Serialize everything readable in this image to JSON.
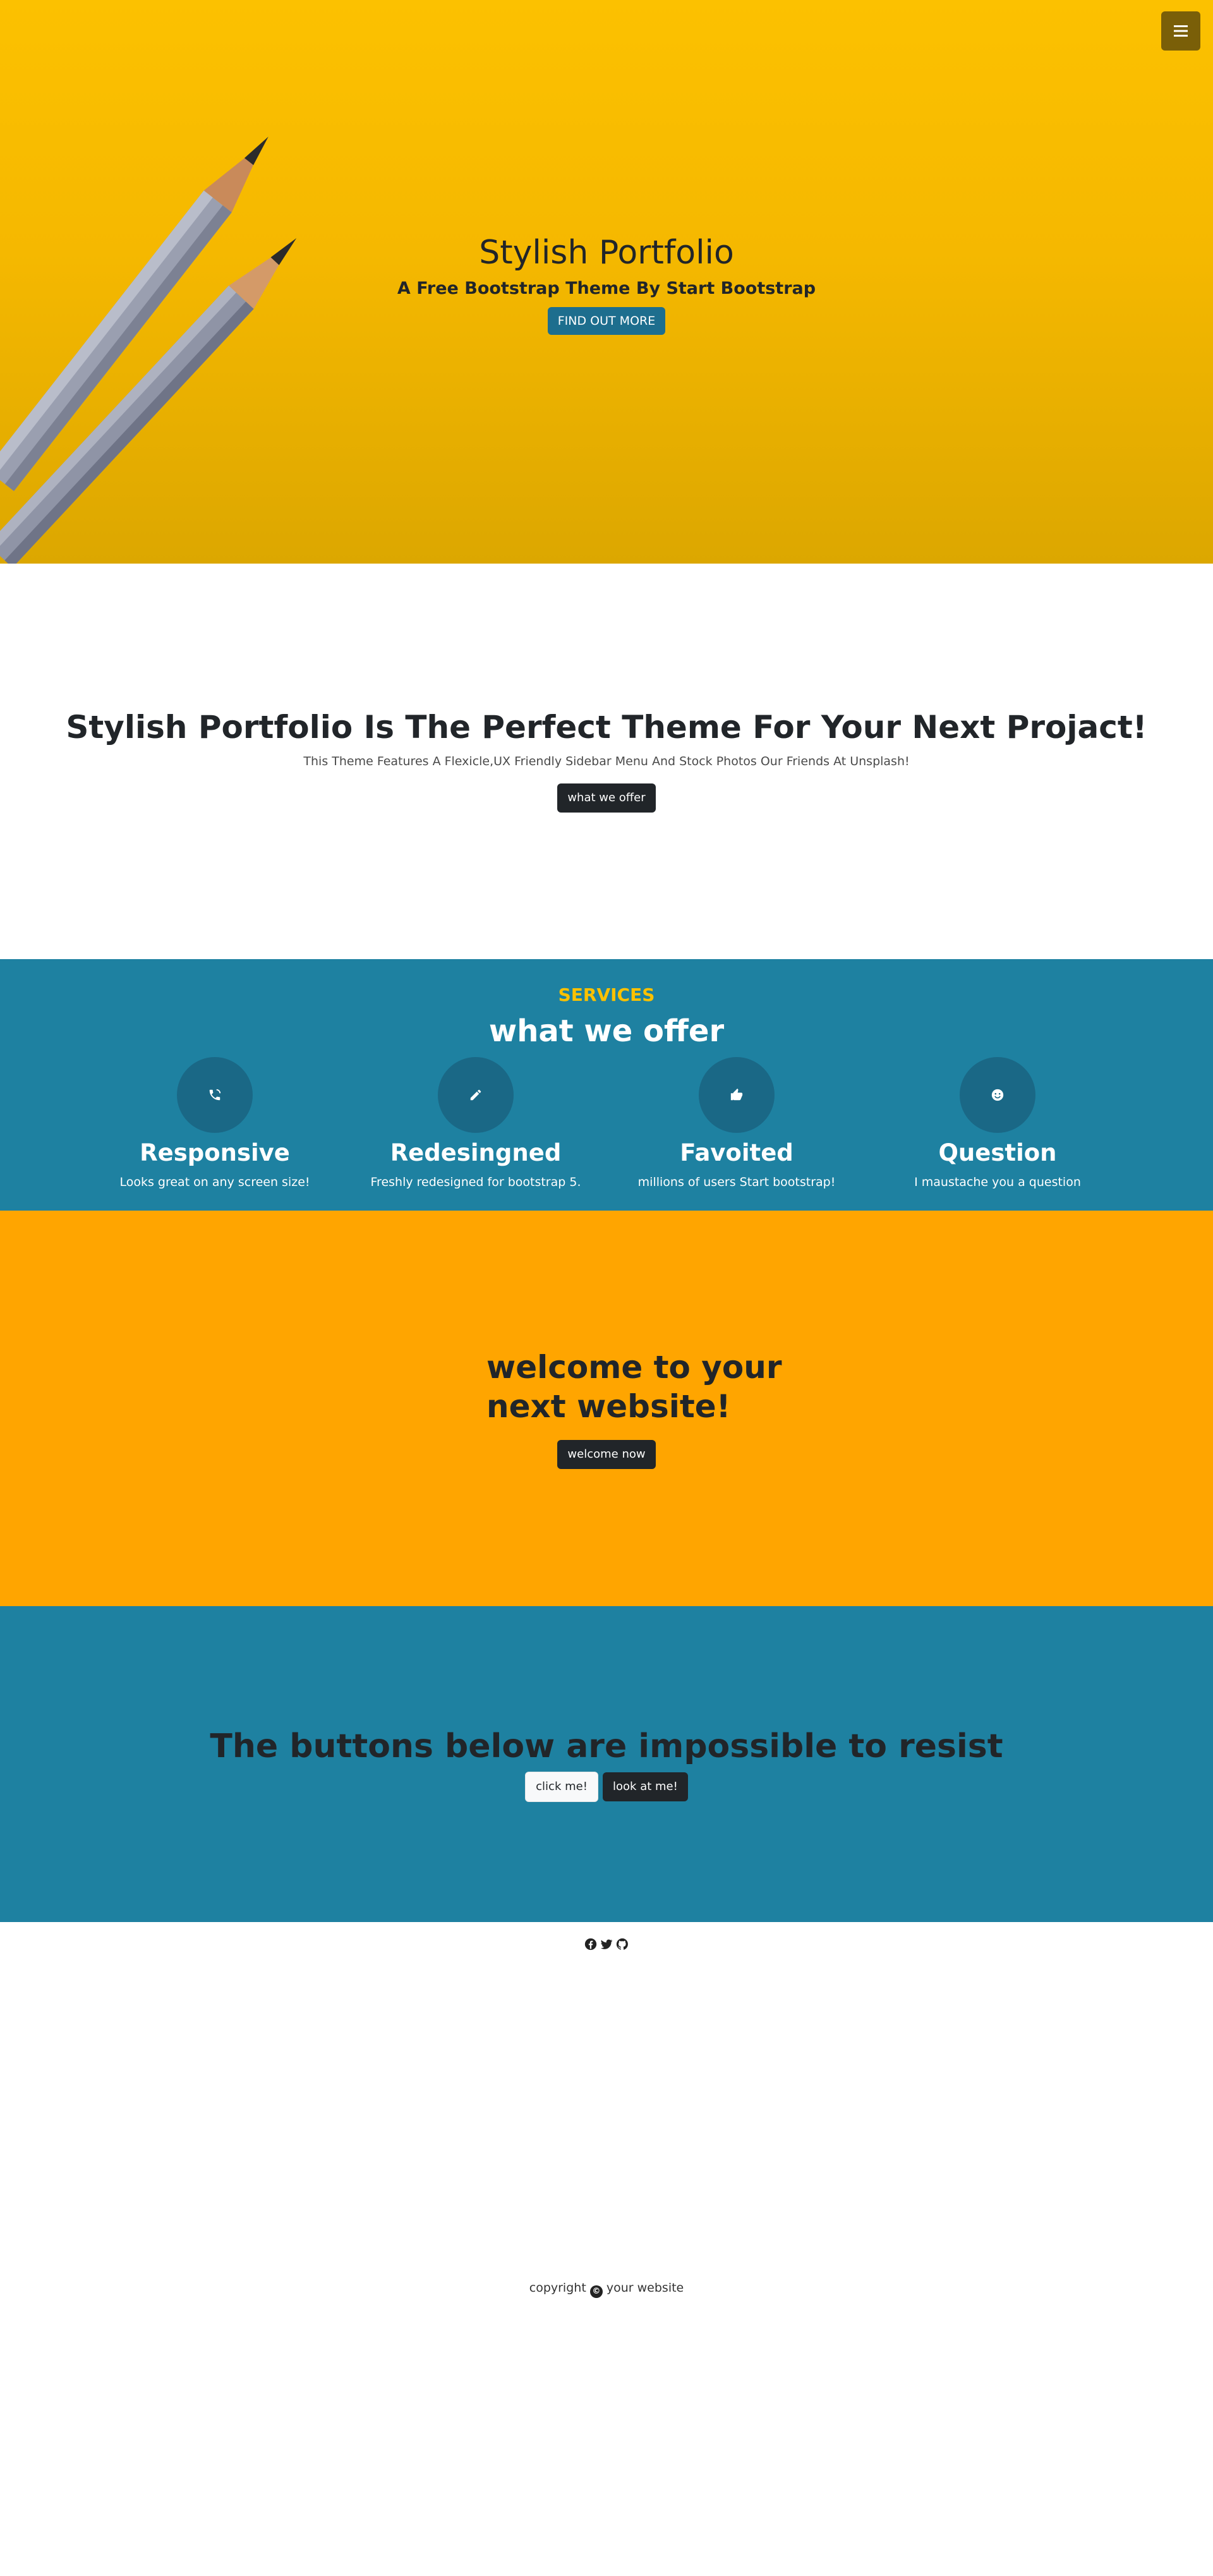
{
  "hero": {
    "title": "Stylish Portfolio",
    "subtitle": "A Free Bootstrap Theme By Start Bootstrap",
    "cta_label": "FIND OUT MORE",
    "menu_icon": "hamburger-icon"
  },
  "about": {
    "title": "Stylish Portfolio Is The Perfect Theme For Your Next Projact!",
    "text": "This Theme Features A Flexicle,UX Friendly Sidebar Menu And Stock Photos Our Friends At Unsplash!",
    "button_label": "what we offer"
  },
  "services": {
    "subheading": "SERVICES",
    "title": "what we offer",
    "items": [
      {
        "icon": "phone-icon",
        "name": "Responsive",
        "text": "Looks great on any screen size!"
      },
      {
        "icon": "pencil-icon",
        "name": "Redesingned",
        "text": "Freshly redesigned for bootstrap 5."
      },
      {
        "icon": "thumbs-up-icon",
        "name": "Favoited",
        "text": "millions of users Start bootstrap!"
      },
      {
        "icon": "smile-icon",
        "name": "Question",
        "text": "I maustache you a question"
      }
    ]
  },
  "callout": {
    "title_line1": "welcome to your",
    "title_line2": "next website!",
    "button_label": "welcome now"
  },
  "cta": {
    "title": "The buttons below are impossible to resist",
    "button1_label": "click me!",
    "button2_label": "look at me!"
  },
  "footer": {
    "social_icons": [
      "facebook-icon",
      "twitter-icon",
      "github-icon"
    ],
    "copyright_prefix": "copyright",
    "copyright_symbol": "©",
    "copyright_suffix": "your website"
  },
  "colors": {
    "hero_yellow": "#fcc100",
    "primary_blue": "#1e81a1",
    "orange": "#ffa500",
    "dark": "#212529"
  }
}
